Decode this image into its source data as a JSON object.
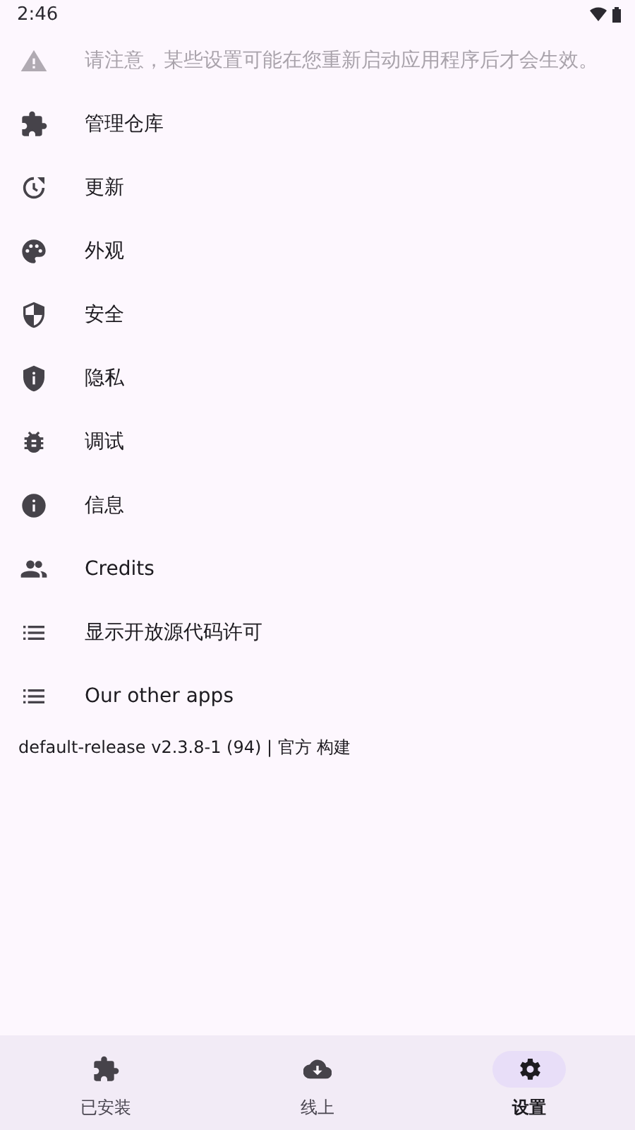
{
  "status_bar": {
    "time": "2:46"
  },
  "notice": "请注意，某些设置可能在您重新启动应用程序后才会生效。",
  "settings": [
    {
      "label": "管理仓库"
    },
    {
      "label": "更新"
    },
    {
      "label": "外观"
    },
    {
      "label": "安全"
    },
    {
      "label": "隐私"
    },
    {
      "label": "调试"
    },
    {
      "label": "信息"
    },
    {
      "label": "Credits"
    },
    {
      "label": "显示开放源代码许可"
    },
    {
      "label": "Our other apps"
    }
  ],
  "version": "default-release v2.3.8-1 (94) | 官方 构建",
  "nav": [
    {
      "label": "已安装",
      "selected": false
    },
    {
      "label": "线上",
      "selected": false
    },
    {
      "label": "设置",
      "selected": true
    }
  ]
}
